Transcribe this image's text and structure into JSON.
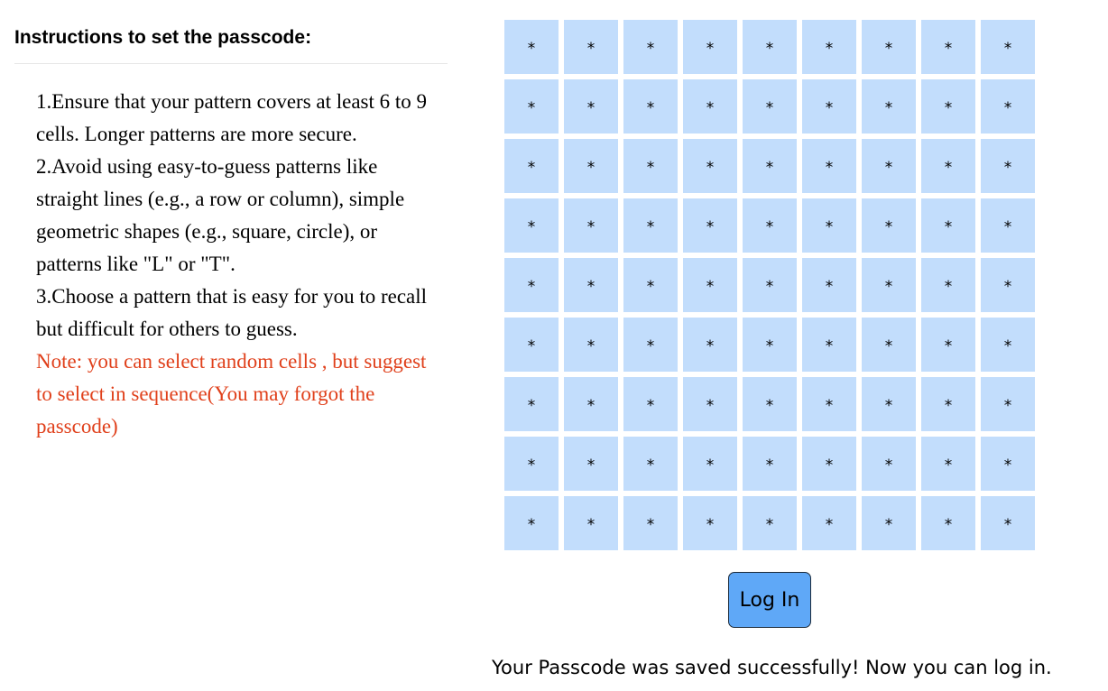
{
  "instructions": {
    "heading": "Instructions to set the passcode:",
    "lines": [
      "1.Ensure that your pattern covers at least 6 to 9 cells. Longer patterns are more secure.",
      "2.Avoid using easy-to-guess patterns like straight lines (e.g., a row or column), simple geometric shapes (e.g., square, circle), or patterns like \"L\" or \"T\".",
      "3.Choose a pattern that is easy for you to recall but difficult for others to guess."
    ],
    "note": "Note: you can select random cells , but suggest to select in sequence(You may forgot the passcode)"
  },
  "grid": {
    "rows": 9,
    "cols": 9,
    "cell_symbol": "*",
    "cell_color": "#c2ddfc"
  },
  "login_button": {
    "label": "Log In",
    "color": "#5fa8f7"
  },
  "status_message": "Your Passcode was saved successfully! Now you can log in.",
  "colors": {
    "note_text": "#e0401b"
  }
}
